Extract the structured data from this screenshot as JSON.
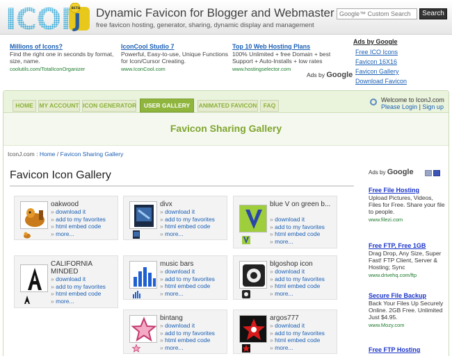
{
  "header": {
    "logo_text": "ICON",
    "logo_letter": "J",
    "logo_badge": "BETA",
    "title": "Dynamic Favicon for Blogger and Webmaster",
    "subtitle": "free favicon hosting, generator, sharing, dynamic display and management",
    "search_placeholder": "Google™ Custom Search",
    "search_button": "Search"
  },
  "top_ads": [
    {
      "title": "Millions of Icons?",
      "text": "Find the right one in seconds by format, size, name.",
      "url": "coolutils.com/TotalIconOrganizer"
    },
    {
      "title": "IconCool Studio 7",
      "text": "Powerful, Easy-to-use, Unique Functions for Icon/Cursor Creating.",
      "url": "www.IconCool.com"
    },
    {
      "title": "Top 10 Web Hosting Plans",
      "text": "100% Unlimited + free Domain + best Support + Auto-Installs + low rates",
      "url": "www.hostingselector.com"
    }
  ],
  "ads_by_google": {
    "prefix": "Ads by",
    "brand": "Google"
  },
  "ad_links": {
    "title": "Ads by Google",
    "items": [
      "Free ICO Icons",
      "Favicon 16X16",
      "Favicon Gallery",
      "Download Favicon"
    ]
  },
  "nav": {
    "tabs": [
      "HOME",
      "MY ACCOUNT",
      "ICON GENERATOR",
      "USER GALLERY",
      "ANIMATED FAVICON",
      "FAQ"
    ],
    "active": "USER GALLERY"
  },
  "welcome": {
    "text": "Welcome to IconJ.com",
    "login": "Please Login",
    "separator": "|",
    "signup": "Sign up"
  },
  "banner": {
    "heading": "Favicon Sharing Gallery"
  },
  "breadcrumb": {
    "site": "IconJ.com :",
    "home": "Home",
    "sep": "/",
    "current": "Favicon Sharing Gallery"
  },
  "gallery": {
    "title": "Favicon Icon Gallery",
    "link_labels": [
      "download it",
      "add to my favorites",
      "html embed code",
      "more..."
    ],
    "bullet": "»",
    "items": [
      {
        "name": "oakwood",
        "icon": "dog-icon"
      },
      {
        "name": "divx",
        "icon": "divx-icon"
      },
      {
        "name": "blue V on green b...",
        "icon": "letter-v-icon"
      },
      {
        "name": "CALIFORNIA MINDED",
        "icon": "letter-a-icon"
      },
      {
        "name": "music bars",
        "icon": "music-bars-icon"
      },
      {
        "name": "blgoshop icon",
        "icon": "blgoshop-icon"
      },
      {
        "name": "bintang",
        "icon": "star-icon"
      },
      {
        "name": "argos777",
        "icon": "argos-star-icon"
      }
    ]
  },
  "side_ads": {
    "label_prefix": "Ads by",
    "label_brand": "Google",
    "items": [
      {
        "title": "Free File Hosting",
        "text": "Upload Pictures, Videos, Files for Free. Share your file to people.",
        "url": "www.filezi.com"
      },
      {
        "title": "Free FTP, Free 1GB",
        "text": "Drag Drop, Any Size, Super Fast! FTP Client, Server & Hosting; Sync",
        "url": "www.drivehq.com/ftp"
      },
      {
        "title": "Secure File Backup",
        "text": "Back Your Files Up Securely Online. 2GB Free. Unlimited Just $4.95.",
        "url": "www.Mozy.com"
      },
      {
        "title": "Free FTP Hosting",
        "text": "",
        "url": ""
      }
    ]
  }
}
